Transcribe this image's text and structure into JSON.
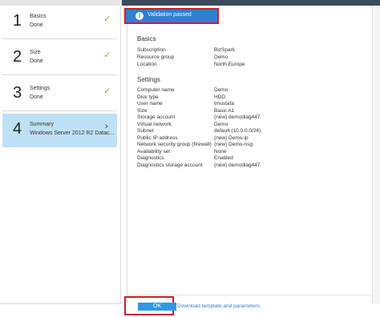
{
  "steps": [
    {
      "number": "1",
      "title": "Basics",
      "subtitle": "Done"
    },
    {
      "number": "2",
      "title": "Size",
      "subtitle": "Done"
    },
    {
      "number": "3",
      "title": "Settings",
      "subtitle": "Done"
    },
    {
      "number": "4",
      "title": "Summary",
      "subtitle": "Windows Server 2012 R2 Datac..."
    }
  ],
  "banner": {
    "text": "Validation passed",
    "icon": "info-icon"
  },
  "basics": {
    "heading": "Basics",
    "rows": [
      {
        "key": "Subscription",
        "value": "BizSpark"
      },
      {
        "key": "Resource group",
        "value": "Demo"
      },
      {
        "key": "Location",
        "value": "North Europe"
      }
    ]
  },
  "settings": {
    "heading": "Settings",
    "rows": [
      {
        "key": "Computer name",
        "value": "Demo"
      },
      {
        "key": "Disk type",
        "value": "HDD"
      },
      {
        "key": "User name",
        "value": "tmustafa"
      },
      {
        "key": "Size",
        "value": "Basic A1"
      },
      {
        "key": "Storage account",
        "value": "(new) demodiag447"
      },
      {
        "key": "Virtual network",
        "value": "Demo"
      },
      {
        "key": "Subnet",
        "value": "default (10.0.0.0/24)"
      },
      {
        "key": "Public IP address",
        "value": "(new) Demo-ip"
      },
      {
        "key": "Network security group (firewall)",
        "value": "(new) Demo-nsg"
      },
      {
        "key": "Availability set",
        "value": "None"
      },
      {
        "key": "Diagnostics",
        "value": "Enabled"
      },
      {
        "key": "Diagnostics storage account",
        "value": "(new) demodiag447"
      }
    ]
  },
  "footer": {
    "ok_label": "OK",
    "download_label": "Download template and parameters"
  },
  "colors": {
    "accent": "#2f7fd1",
    "highlight": "#c8202c",
    "done_check": "#7ab52b"
  }
}
